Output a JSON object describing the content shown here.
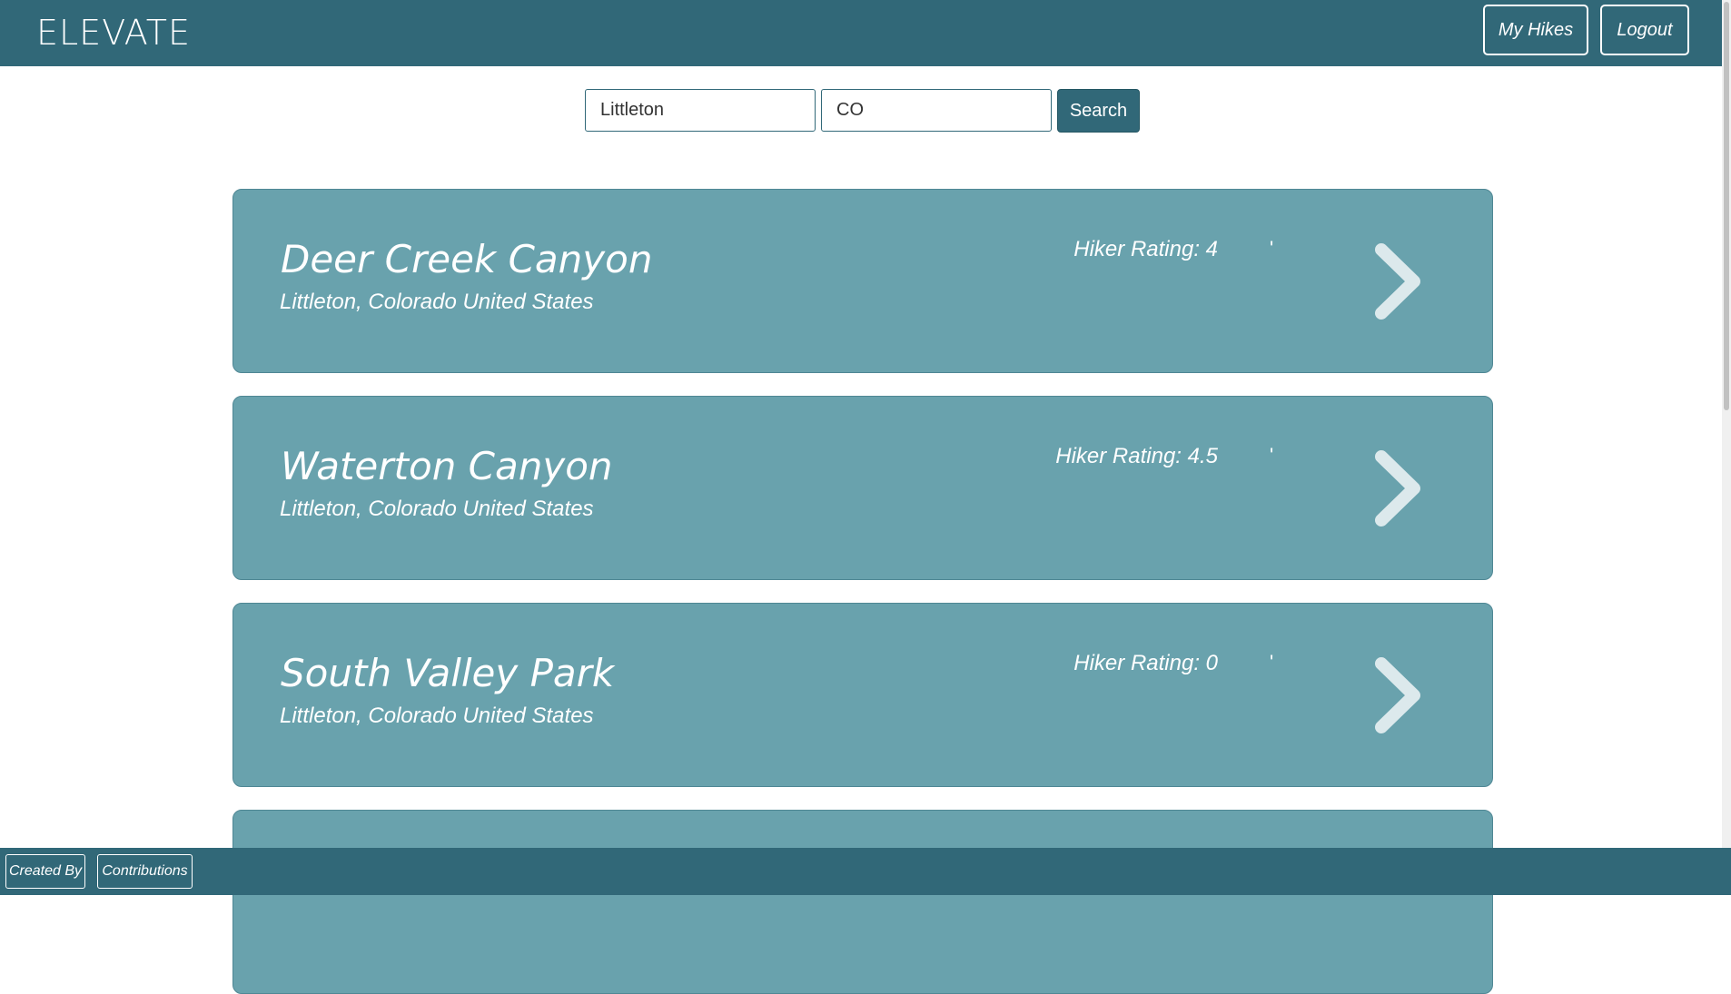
{
  "header": {
    "logo_text": "ELEVATE",
    "my_hikes_label": "My Hikes",
    "logout_label": "Logout"
  },
  "search": {
    "city_value": "Littleton",
    "state_value": "CO",
    "button_label": "Search"
  },
  "trails": [
    {
      "name": "Deer Creek Canyon",
      "location": "Littleton, Colorado United States",
      "rating_text": "Hiker Rating: 4",
      "tick": "'"
    },
    {
      "name": "Waterton Canyon",
      "location": "Littleton, Colorado United States",
      "rating_text": "Hiker Rating: 4.5",
      "tick": "'"
    },
    {
      "name": "South Valley Park",
      "location": "Littleton, Colorado United States",
      "rating_text": "Hiker Rating: 0",
      "tick": "'"
    }
  ],
  "footer": {
    "created_by_label": "Created By",
    "contributions_label": "Contributions"
  },
  "colors": {
    "primary": "#316878",
    "card": "#69a2ad",
    "chevron": "#dce9ec"
  }
}
